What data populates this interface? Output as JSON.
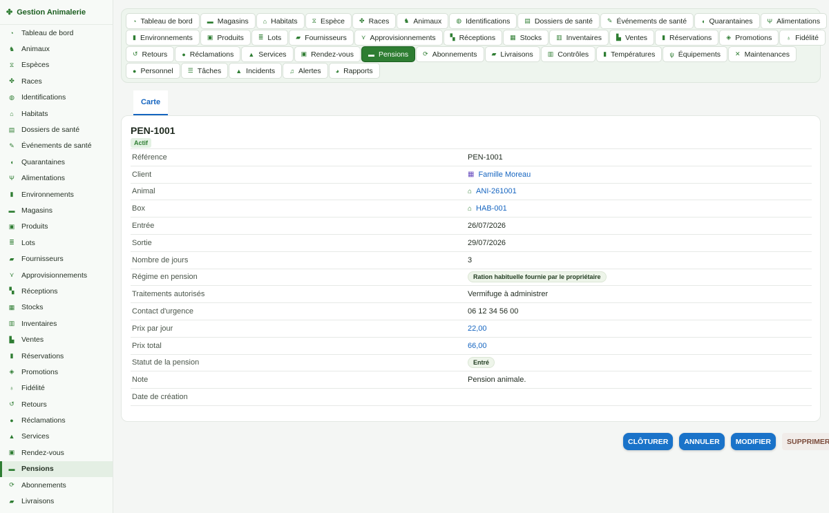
{
  "app": {
    "title": "Gestion Animalerie"
  },
  "sidebar": {
    "items": [
      {
        "label": "Tableau de bord",
        "icon": "gauge-icon",
        "glyph": "◔"
      },
      {
        "label": "Animaux",
        "icon": "dog-icon",
        "glyph": "♞"
      },
      {
        "label": "Espèces",
        "icon": "dna-icon",
        "glyph": "⧖"
      },
      {
        "label": "Races",
        "icon": "paw-icon",
        "glyph": "✤"
      },
      {
        "label": "Identifications",
        "icon": "fingerprint-icon",
        "glyph": "◍"
      },
      {
        "label": "Habitats",
        "icon": "house-icon",
        "glyph": "⌂"
      },
      {
        "label": "Dossiers de santé",
        "icon": "file-medical-icon",
        "glyph": "▤"
      },
      {
        "label": "Événements de santé",
        "icon": "syringe-icon",
        "glyph": "✎"
      },
      {
        "label": "Quarantaines",
        "icon": "shield-icon",
        "glyph": "◖"
      },
      {
        "label": "Alimentations",
        "icon": "utensils-icon",
        "glyph": "Ψ"
      },
      {
        "label": "Environnements",
        "icon": "thermometer-icon",
        "glyph": "▮"
      },
      {
        "label": "Magasins",
        "icon": "store-icon",
        "glyph": "▬"
      },
      {
        "label": "Produits",
        "icon": "box-icon",
        "glyph": "▣"
      },
      {
        "label": "Lots",
        "icon": "list-icon",
        "glyph": "≣"
      },
      {
        "label": "Fournisseurs",
        "icon": "truck-icon",
        "glyph": "▰"
      },
      {
        "label": "Approvisionnements",
        "icon": "dolly-icon",
        "glyph": "⋎"
      },
      {
        "label": "Réceptions",
        "icon": "boxes-icon",
        "glyph": "▚"
      },
      {
        "label": "Stocks",
        "icon": "warehouse-icon",
        "glyph": "▦"
      },
      {
        "label": "Inventaires",
        "icon": "clipboard-check-icon",
        "glyph": "▥"
      },
      {
        "label": "Ventes",
        "icon": "cash-register-icon",
        "glyph": "▙"
      },
      {
        "label": "Réservations",
        "icon": "bookmark-icon",
        "glyph": "▮"
      },
      {
        "label": "Promotions",
        "icon": "tags-icon",
        "glyph": "◈"
      },
      {
        "label": "Fidélité",
        "icon": "award-icon",
        "glyph": "♁"
      },
      {
        "label": "Retours",
        "icon": "undo-icon",
        "glyph": "↺"
      },
      {
        "label": "Réclamations",
        "icon": "comment-icon",
        "glyph": "●"
      },
      {
        "label": "Services",
        "icon": "bell-concierge-icon",
        "glyph": "▲"
      },
      {
        "label": "Rendez-vous",
        "icon": "calendar-check-icon",
        "glyph": "▣"
      },
      {
        "label": "Pensions",
        "icon": "bed-icon",
        "glyph": "▬",
        "active": true
      },
      {
        "label": "Abonnements",
        "icon": "refresh-icon",
        "glyph": "⟳"
      },
      {
        "label": "Livraisons",
        "icon": "truck-fast-icon",
        "glyph": "▰"
      }
    ]
  },
  "tabs": {
    "rows": [
      [
        {
          "label": "Tableau de bord",
          "icon": "gauge-icon",
          "glyph": "◔"
        },
        {
          "label": "Magasins",
          "icon": "store-icon",
          "glyph": "▬"
        },
        {
          "label": "Habitats",
          "icon": "house-icon",
          "glyph": "⌂"
        },
        {
          "label": "Espèce",
          "icon": "dna-icon",
          "glyph": "⧖"
        },
        {
          "label": "Races",
          "icon": "paw-icon",
          "glyph": "✤"
        },
        {
          "label": "Animaux",
          "icon": "dog-icon",
          "glyph": "♞"
        },
        {
          "label": "Identifications",
          "icon": "fingerprint-icon",
          "glyph": "◍"
        },
        {
          "label": "Dossiers de santé",
          "icon": "file-medical-icon",
          "glyph": "▤"
        },
        {
          "label": "Événements de santé",
          "icon": "syringe-icon",
          "glyph": "✎"
        },
        {
          "label": "Quarantaines",
          "icon": "shield-icon",
          "glyph": "◖"
        },
        {
          "label": "Alimentations",
          "icon": "utensils-icon",
          "glyph": "Ψ"
        }
      ],
      [
        {
          "label": "Environnements",
          "icon": "thermometer-icon",
          "glyph": "▮"
        },
        {
          "label": "Produits",
          "icon": "box-icon",
          "glyph": "▣"
        },
        {
          "label": "Lots",
          "icon": "list-icon",
          "glyph": "≣"
        },
        {
          "label": "Fournisseurs",
          "icon": "truck-icon",
          "glyph": "▰"
        },
        {
          "label": "Approvisionnements",
          "icon": "dolly-icon",
          "glyph": "⋎"
        },
        {
          "label": "Réceptions",
          "icon": "boxes-icon",
          "glyph": "▚"
        },
        {
          "label": "Stocks",
          "icon": "warehouse-icon",
          "glyph": "▦"
        },
        {
          "label": "Inventaires",
          "icon": "clipboard-check-icon",
          "glyph": "▥"
        },
        {
          "label": "Ventes",
          "icon": "cash-register-icon",
          "glyph": "▙"
        },
        {
          "label": "Réservations",
          "icon": "bookmark-icon",
          "glyph": "▮"
        },
        {
          "label": "Promotions",
          "icon": "tags-icon",
          "glyph": "◈"
        },
        {
          "label": "Fidélité",
          "icon": "award-icon",
          "glyph": "♁"
        }
      ],
      [
        {
          "label": "Retours",
          "icon": "undo-icon",
          "glyph": "↺"
        },
        {
          "label": "Réclamations",
          "icon": "comment-icon",
          "glyph": "●"
        },
        {
          "label": "Services",
          "icon": "bell-concierge-icon",
          "glyph": "▲"
        },
        {
          "label": "Rendez-vous",
          "icon": "calendar-check-icon",
          "glyph": "▣"
        },
        {
          "label": "Pensions",
          "icon": "bed-icon",
          "glyph": "▬",
          "active": true
        },
        {
          "label": "Abonnements",
          "icon": "refresh-icon",
          "glyph": "⟳"
        },
        {
          "label": "Livraisons",
          "icon": "truck-fast-icon",
          "glyph": "▰"
        },
        {
          "label": "Contrôles",
          "icon": "clipboard-icon",
          "glyph": "▥"
        },
        {
          "label": "Températures",
          "icon": "thermometer-icon",
          "glyph": "▮"
        },
        {
          "label": "Équipements",
          "icon": "plug-icon",
          "glyph": "ψ"
        },
        {
          "label": "Maintenances",
          "icon": "tools-icon",
          "glyph": "✕"
        }
      ],
      [
        {
          "label": "Personnel",
          "icon": "users-icon",
          "glyph": "●"
        },
        {
          "label": "Tâches",
          "icon": "tasks-icon",
          "glyph": "☰"
        },
        {
          "label": "Incidents",
          "icon": "warning-icon",
          "glyph": "▲"
        },
        {
          "label": "Alertes",
          "icon": "bell-icon",
          "glyph": "♫"
        },
        {
          "label": "Rapports",
          "icon": "chart-pie-icon",
          "glyph": "◕"
        }
      ]
    ]
  },
  "view_tab": {
    "label": "Carte"
  },
  "record": {
    "title": "PEN-1001",
    "status_badge": "Actif",
    "fields": [
      {
        "label": "Référence",
        "value": "PEN-1001"
      },
      {
        "label": "Client",
        "value": "Famille Moreau",
        "type": "link",
        "icon": "building-icon",
        "glyph": "▦",
        "icon_color": "purple"
      },
      {
        "label": "Animal",
        "value": "ANI-261001",
        "type": "link",
        "icon": "house-icon",
        "glyph": "⌂",
        "icon_color": "green"
      },
      {
        "label": "Box",
        "value": "HAB-001",
        "type": "link",
        "icon": "house-icon",
        "glyph": "⌂",
        "icon_color": "green"
      },
      {
        "label": "Entrée",
        "value": "26/07/2026"
      },
      {
        "label": "Sortie",
        "value": "29/07/2026"
      },
      {
        "label": "Nombre de jours",
        "value": "3"
      },
      {
        "label": "Régime en pension",
        "value": "Ration habituelle fournie par le propriétaire",
        "type": "pill"
      },
      {
        "label": "Traitements autorisés",
        "value": "Vermifuge à administrer"
      },
      {
        "label": "Contact d'urgence",
        "value": "06 12 34 56 00"
      },
      {
        "label": "Prix par jour",
        "value": "22,00",
        "type": "link"
      },
      {
        "label": "Prix total",
        "value": "66,00",
        "type": "link"
      },
      {
        "label": "Statut de la pension",
        "value": "Entré",
        "type": "pill"
      },
      {
        "label": "Note",
        "value": "Pension animale."
      },
      {
        "label": "Date de création",
        "value": ""
      }
    ]
  },
  "actions": {
    "close_label": "CLÔTURER",
    "cancel_label": "ANNULER",
    "edit_label": "MODIFIER",
    "delete_label": "SUPPRIMER"
  },
  "colors": {
    "accent": "#2e7d32",
    "link": "#1565c0",
    "primary_button": "#1a73c9"
  }
}
